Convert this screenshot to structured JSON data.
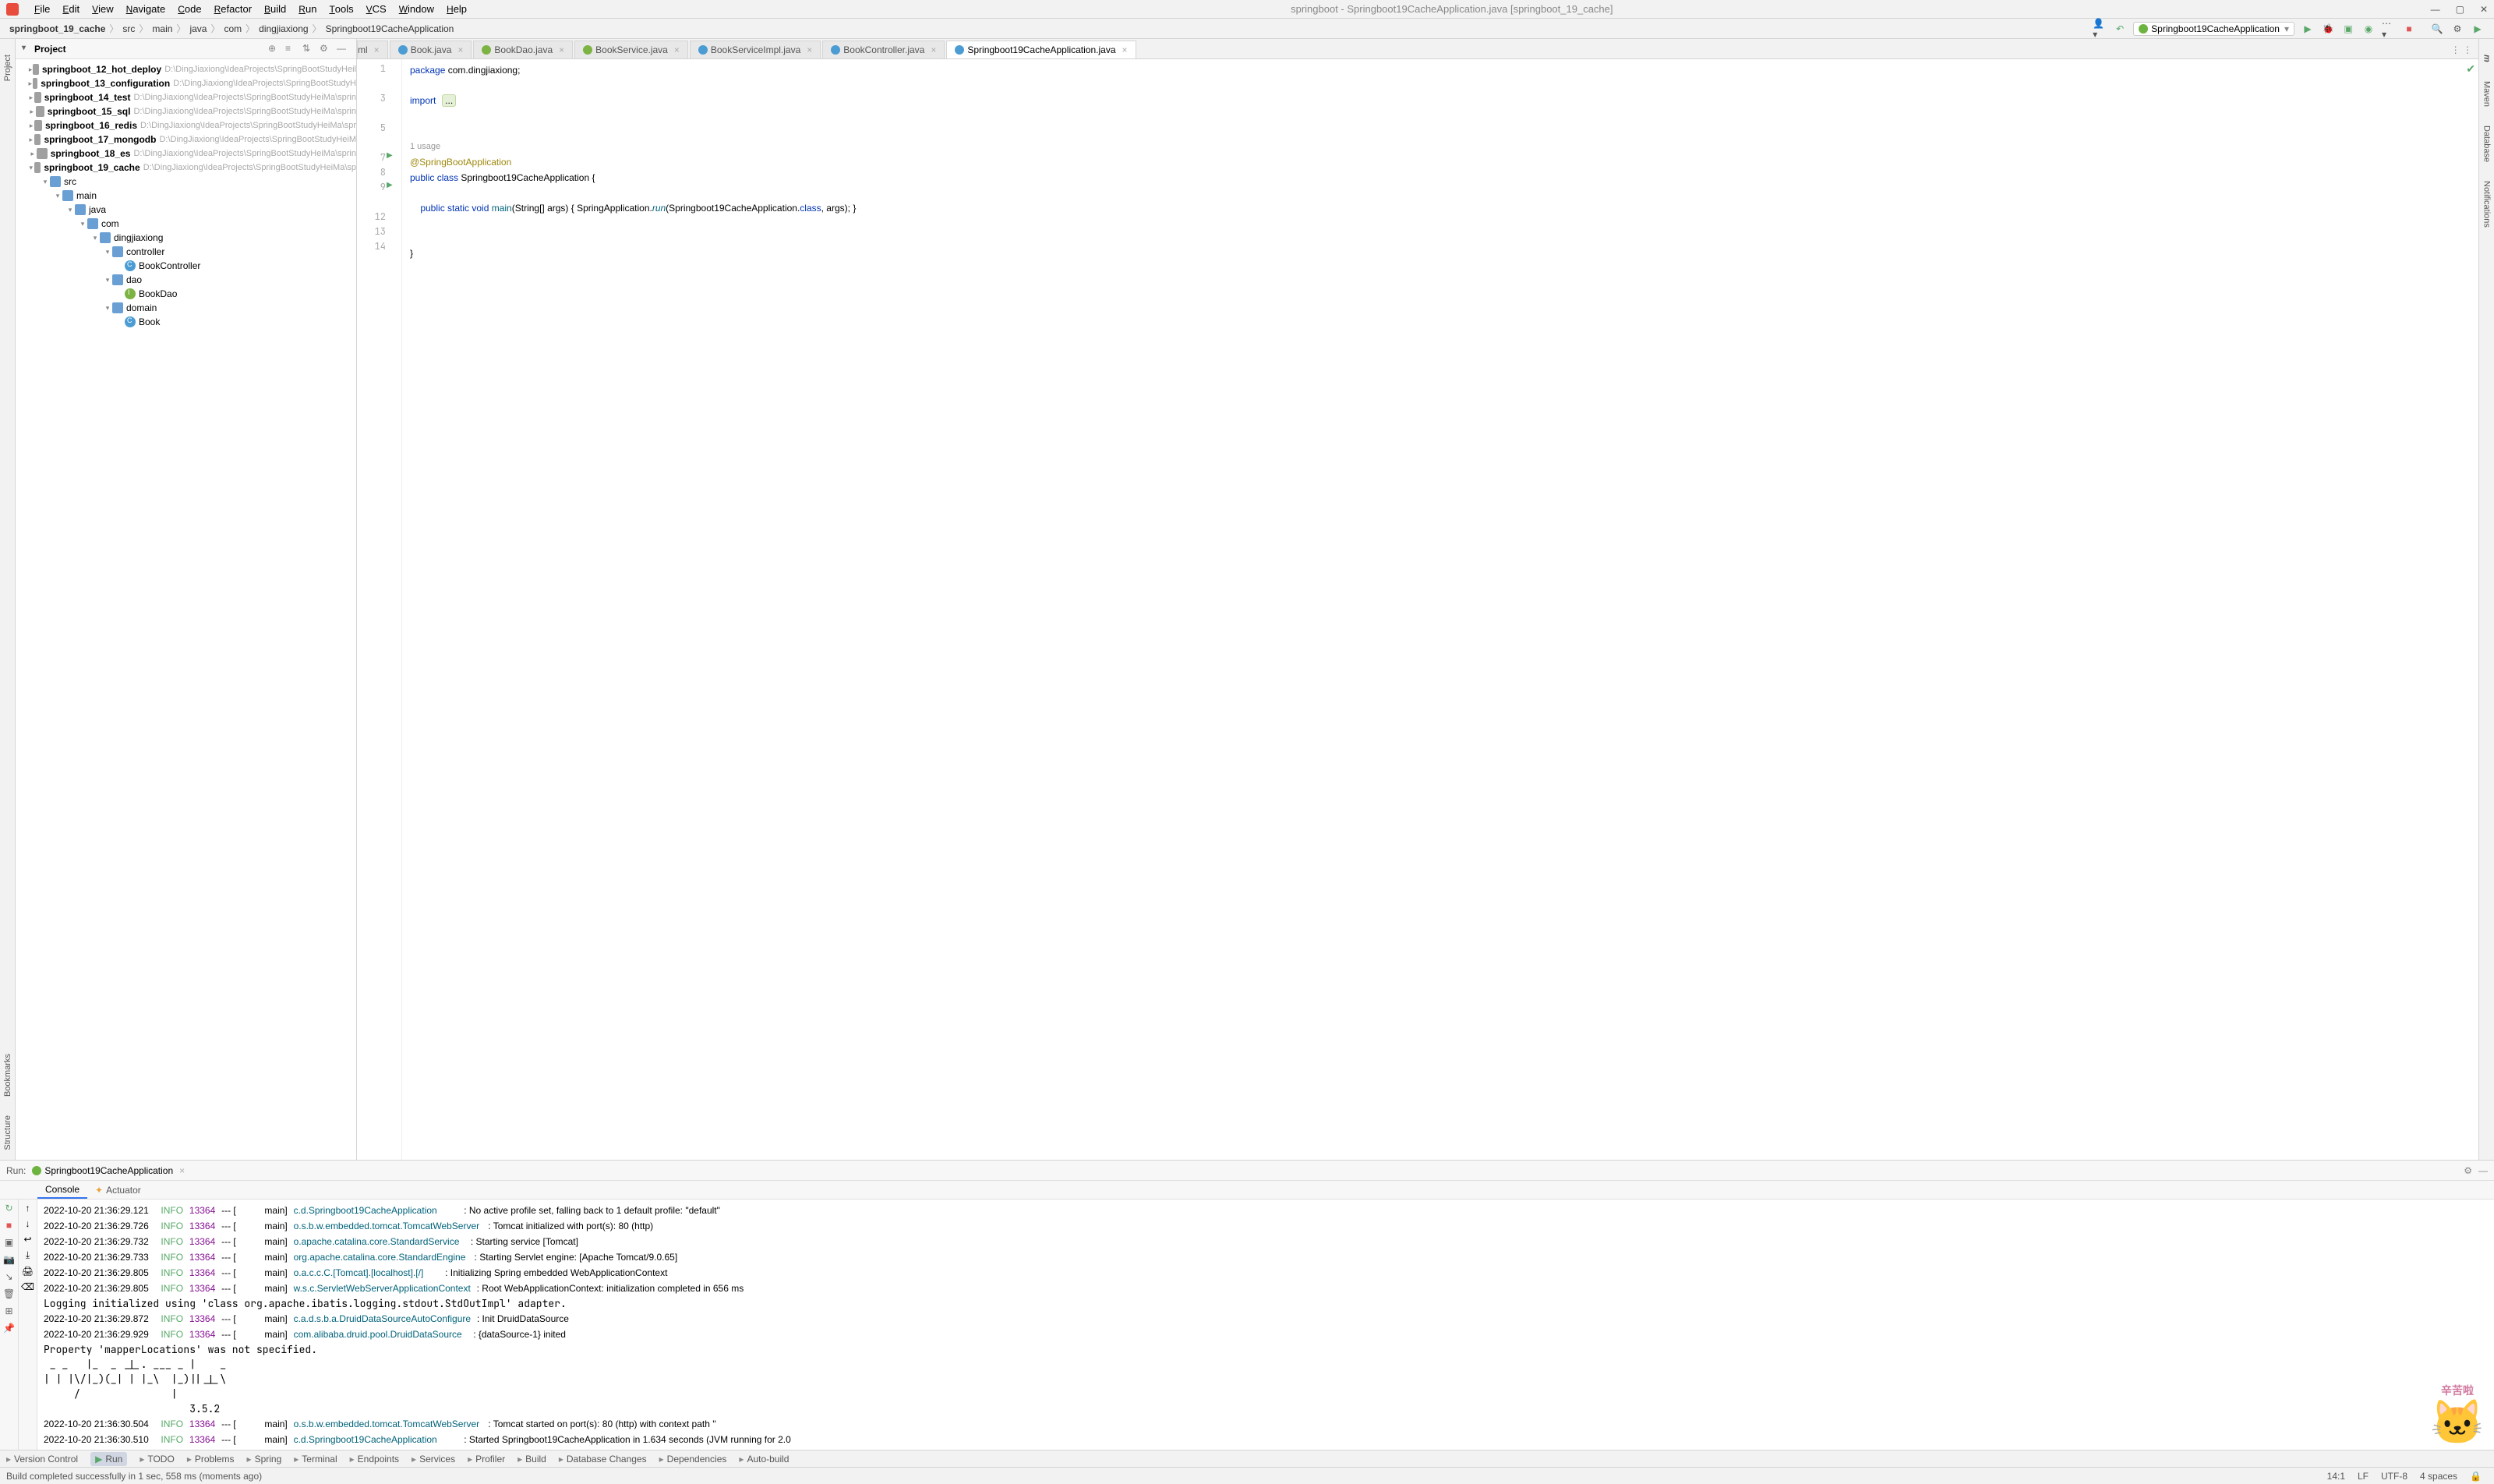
{
  "window": {
    "title": "springboot - Springboot19CacheApplication.java [springboot_19_cache]"
  },
  "menubar": {
    "items": [
      "File",
      "Edit",
      "View",
      "Navigate",
      "Code",
      "Refactor",
      "Build",
      "Run",
      "Tools",
      "VCS",
      "Window",
      "Help"
    ]
  },
  "breadcrumb": {
    "parts": [
      "springboot_19_cache",
      "src",
      "main",
      "java",
      "com",
      "dingjiaxiong",
      "Springboot19CacheApplication"
    ]
  },
  "run_config": {
    "name": "Springboot19CacheApplication"
  },
  "project_panel": {
    "title": "Project"
  },
  "tree": {
    "rows": [
      {
        "indent": 1,
        "arrow": "▸",
        "icon": "module",
        "name": "springboot_12_hot_deploy",
        "bold": true,
        "path": "D:\\DingJiaxiong\\IdeaProjects\\SpringBootStudyHeil"
      },
      {
        "indent": 1,
        "arrow": "▸",
        "icon": "module",
        "name": "springboot_13_configuration",
        "bold": true,
        "path": "D:\\DingJiaxiong\\IdeaProjects\\SpringBootStudyH"
      },
      {
        "indent": 1,
        "arrow": "▸",
        "icon": "module",
        "name": "springboot_14_test",
        "bold": true,
        "path": "D:\\DingJiaxiong\\IdeaProjects\\SpringBootStudyHeiMa\\sprin"
      },
      {
        "indent": 1,
        "arrow": "▸",
        "icon": "module",
        "name": "springboot_15_sql",
        "bold": true,
        "path": "D:\\DingJiaxiong\\IdeaProjects\\SpringBootStudyHeiMa\\sprin"
      },
      {
        "indent": 1,
        "arrow": "▸",
        "icon": "module",
        "name": "springboot_16_redis",
        "bold": true,
        "path": "D:\\DingJiaxiong\\IdeaProjects\\SpringBootStudyHeiMa\\spr"
      },
      {
        "indent": 1,
        "arrow": "▸",
        "icon": "module",
        "name": "springboot_17_mongodb",
        "bold": true,
        "path": "D:\\DingJiaxiong\\IdeaProjects\\SpringBootStudyHeiM"
      },
      {
        "indent": 1,
        "arrow": "▸",
        "icon": "module",
        "name": "springboot_18_es",
        "bold": true,
        "path": "D:\\DingJiaxiong\\IdeaProjects\\SpringBootStudyHeiMa\\sprin"
      },
      {
        "indent": 1,
        "arrow": "▾",
        "icon": "module",
        "name": "springboot_19_cache",
        "bold": true,
        "path": "D:\\DingJiaxiong\\IdeaProjects\\SpringBootStudyHeiMa\\sp"
      },
      {
        "indent": 2,
        "arrow": "▾",
        "icon": "folder",
        "name": "src"
      },
      {
        "indent": 3,
        "arrow": "▾",
        "icon": "folder",
        "name": "main"
      },
      {
        "indent": 4,
        "arrow": "▾",
        "icon": "folder",
        "name": "java"
      },
      {
        "indent": 5,
        "arrow": "▾",
        "icon": "folder",
        "name": "com"
      },
      {
        "indent": 6,
        "arrow": "▾",
        "icon": "folder",
        "name": "dingjiaxiong"
      },
      {
        "indent": 7,
        "arrow": "▾",
        "icon": "folder",
        "name": "controller"
      },
      {
        "indent": 8,
        "arrow": " ",
        "icon": "class",
        "name": "BookController"
      },
      {
        "indent": 7,
        "arrow": "▾",
        "icon": "folder",
        "name": "dao"
      },
      {
        "indent": 8,
        "arrow": " ",
        "icon": "iface",
        "name": "BookDao"
      },
      {
        "indent": 7,
        "arrow": "▾",
        "icon": "folder",
        "name": "domain"
      },
      {
        "indent": 8,
        "arrow": " ",
        "icon": "class",
        "name": "Book"
      }
    ]
  },
  "editor_tabs": {
    "partial": "ml",
    "tabs": [
      {
        "label": "Book.java",
        "icon": "class"
      },
      {
        "label": "BookDao.java",
        "icon": "iface"
      },
      {
        "label": "BookService.java",
        "icon": "iface"
      },
      {
        "label": "BookServiceImpl.java",
        "icon": "class"
      },
      {
        "label": "BookController.java",
        "icon": "class"
      },
      {
        "label": "Springboot19CacheApplication.java",
        "icon": "class",
        "active": true
      }
    ]
  },
  "editor": {
    "usage": "1 usage",
    "lines": {
      "l1_kw": "package",
      "l1_rest": " com.dingjiaxiong;",
      "l3_kw": "import",
      "l3_fold": "...",
      "l7": "@SpringBootApplication",
      "l8a": "public class",
      "l8b": " Springboot19CacheApplication {",
      "l9a": "    public static void",
      "l9b": " main",
      "l9c": "(String[] args) { SpringApplication.",
      "l9d": "run",
      "l9e": "(Springboot19CacheApplication.",
      "l9f": "class",
      "l9g": ", args); }",
      "l13": "}"
    }
  },
  "run_panel": {
    "label": "Run:",
    "config": "Springboot19CacheApplication",
    "subtabs": [
      "Console",
      "Actuator"
    ]
  },
  "console_lines": [
    {
      "ts": "2022-10-20 21:36:29.121",
      "lvl": "INFO",
      "pid": "13364",
      "sep": "--- [           main]",
      "cls": "c.d.Springboot19CacheApplication        ",
      "msg": ": No active profile set, falling back to 1 default profile: \"default\""
    },
    {
      "ts": "2022-10-20 21:36:29.726",
      "lvl": "INFO",
      "pid": "13364",
      "sep": "--- [           main]",
      "cls": "o.s.b.w.embedded.tomcat.TomcatWebServer ",
      "msg": ": Tomcat initialized with port(s): 80 (http)"
    },
    {
      "ts": "2022-10-20 21:36:29.732",
      "lvl": "INFO",
      "pid": "13364",
      "sep": "--- [           main]",
      "cls": "o.apache.catalina.core.StandardService  ",
      "msg": ": Starting service [Tomcat]"
    },
    {
      "ts": "2022-10-20 21:36:29.733",
      "lvl": "INFO",
      "pid": "13364",
      "sep": "--- [           main]",
      "cls": "org.apache.catalina.core.StandardEngine ",
      "msg": ": Starting Servlet engine: [Apache Tomcat/9.0.65]"
    },
    {
      "ts": "2022-10-20 21:36:29.805",
      "lvl": "INFO",
      "pid": "13364",
      "sep": "--- [           main]",
      "cls": "o.a.c.c.C.[Tomcat].[localhost].[/]      ",
      "msg": ": Initializing Spring embedded WebApplicationContext"
    },
    {
      "ts": "2022-10-20 21:36:29.805",
      "lvl": "INFO",
      "pid": "13364",
      "sep": "--- [           main]",
      "cls": "w.s.c.ServletWebServerApplicationContext",
      "msg": ": Root WebApplicationContext: initialization completed in 656 ms"
    },
    {
      "plain": "Logging initialized using 'class org.apache.ibatis.logging.stdout.StdOutImpl' adapter."
    },
    {
      "ts": "2022-10-20 21:36:29.872",
      "lvl": "INFO",
      "pid": "13364",
      "sep": "--- [           main]",
      "cls": "c.a.d.s.b.a.DruidDataSourceAutoConfigure",
      "msg": ": Init DruidDataSource"
    },
    {
      "ts": "2022-10-20 21:36:29.929",
      "lvl": "INFO",
      "pid": "13364",
      "sep": "--- [           main]",
      "cls": "com.alibaba.druid.pool.DruidDataSource  ",
      "msg": ": {dataSource-1} inited"
    },
    {
      "plain": "Property 'mapperLocations' was not specified."
    },
    {
      "plain": " _ _   |_  _ _|_. ___ _ |    _ "
    },
    {
      "plain": "| | |\\/|_)(_| | |_\\  |_)||_|_\\ "
    },
    {
      "plain": "     /               |         "
    },
    {
      "plain": "                        3.5.2 "
    },
    {
      "ts": "2022-10-20 21:36:30.504",
      "lvl": "INFO",
      "pid": "13364",
      "sep": "--- [           main]",
      "cls": "o.s.b.w.embedded.tomcat.TomcatWebServer ",
      "msg": ": Tomcat started on port(s): 80 (http) with context path ''"
    },
    {
      "ts": "2022-10-20 21:36:30.510",
      "lvl": "INFO",
      "pid": "13364",
      "sep": "--- [           main]",
      "cls": "c.d.Springboot19CacheApplication        ",
      "msg": ": Started Springboot19CacheApplication in 1.634 seconds (JVM running for 2.0"
    }
  ],
  "bottom_tools": {
    "items": [
      {
        "label": "Version Control"
      },
      {
        "label": "Run",
        "active": true
      },
      {
        "label": "TODO"
      },
      {
        "label": "Problems"
      },
      {
        "label": "Spring"
      },
      {
        "label": "Terminal"
      },
      {
        "label": "Endpoints"
      },
      {
        "label": "Services"
      },
      {
        "label": "Profiler"
      },
      {
        "label": "Build"
      },
      {
        "label": "Database Changes"
      },
      {
        "label": "Dependencies"
      },
      {
        "label": "Auto-build"
      }
    ]
  },
  "status_bar": {
    "msg": "Build completed successfully in 1 sec, 558 ms (moments ago)",
    "caret": "14:1",
    "eol": "LF",
    "enc": "UTF-8",
    "indent": "4 spaces"
  },
  "left_tabs": [
    "Project",
    "Bookmarks",
    "Structure"
  ],
  "right_tabs": [
    "m",
    "Maven",
    "Database",
    "Notifications"
  ],
  "mascot_label": "辛苦啦"
}
